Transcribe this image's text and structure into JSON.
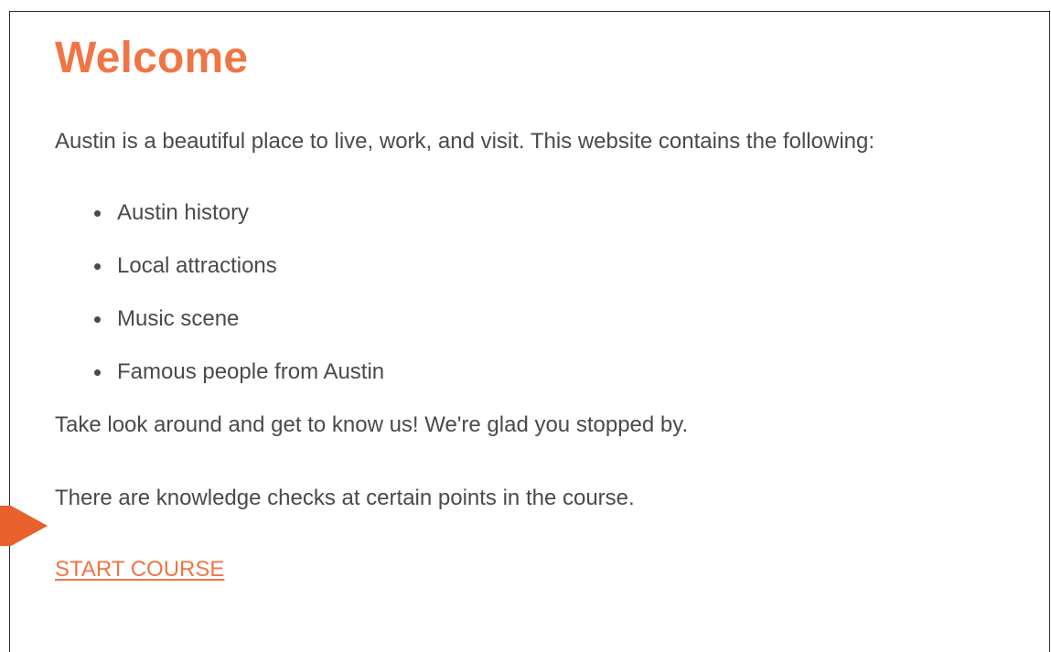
{
  "page": {
    "title": "Welcome",
    "intro": "Austin is a beautiful place to live, work, and visit. This website contains the following:",
    "list_items": [
      "Austin history",
      "Local attractions",
      "Music scene",
      "Famous people from Austin"
    ],
    "take_look": "Take look around and get to know us! We're glad you stopped by.",
    "knowledge_checks": "There are knowledge checks at certain points in the course.",
    "start_link": "START COURSE"
  },
  "colors": {
    "accent": "#f07545",
    "text": "#4a4a4a",
    "border": "#2b2b2b",
    "callout_arrow": "#e8602c"
  }
}
